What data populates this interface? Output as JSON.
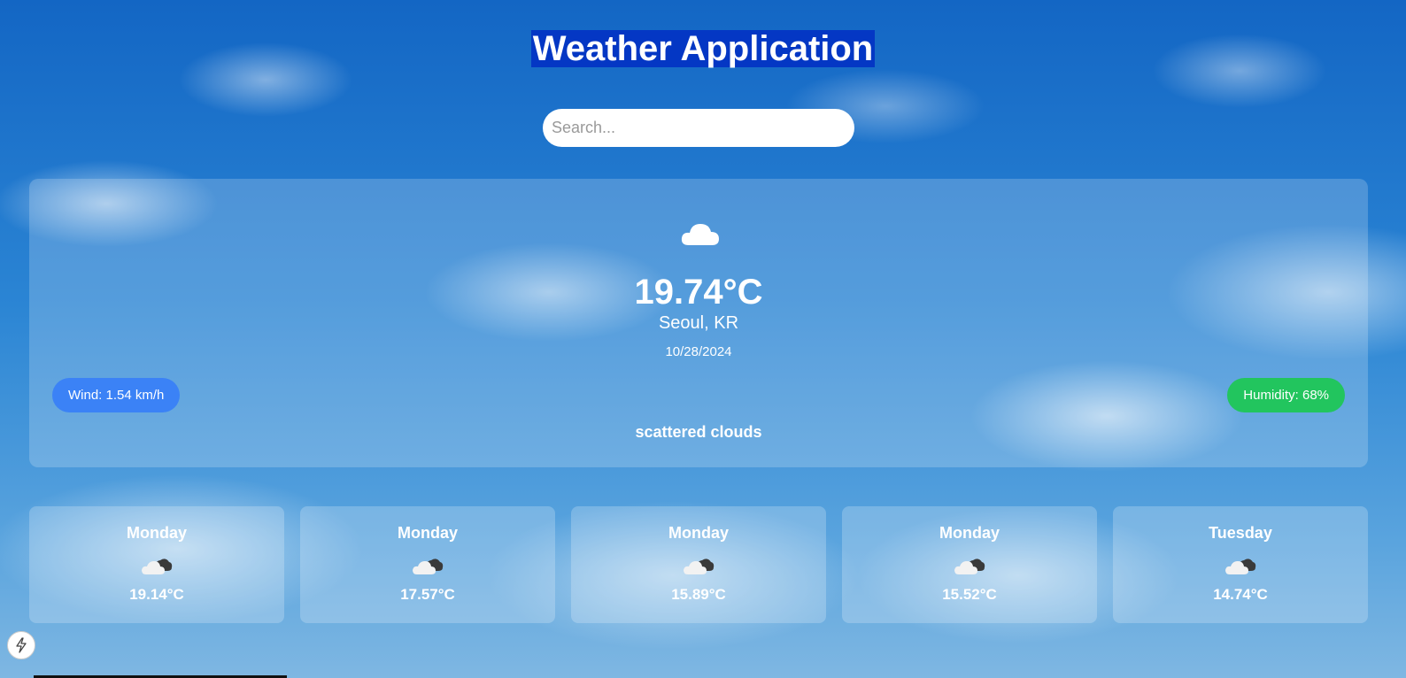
{
  "app": {
    "title": "Weather Application"
  },
  "search": {
    "placeholder": "Search...",
    "value": ""
  },
  "current": {
    "icon": "cloud-icon",
    "temperature": "19.74°C",
    "location": "Seoul, KR",
    "date": "10/28/2024",
    "wind": "Wind: 1.54 km/h",
    "humidity": "Humidity: 68%",
    "description": "scattered clouds"
  },
  "forecast": [
    {
      "day": "Monday",
      "icon": "broken-clouds-icon",
      "temp": "19.14°C"
    },
    {
      "day": "Monday",
      "icon": "broken-clouds-icon",
      "temp": "17.57°C"
    },
    {
      "day": "Monday",
      "icon": "broken-clouds-icon",
      "temp": "15.89°C"
    },
    {
      "day": "Monday",
      "icon": "broken-clouds-icon",
      "temp": "15.52°C"
    },
    {
      "day": "Tuesday",
      "icon": "broken-clouds-icon",
      "temp": "14.74°C"
    }
  ],
  "colors": {
    "title_bg": "#0437c4",
    "wind_pill": "#3b82f6",
    "humidity_pill": "#22c55e"
  },
  "extras": {
    "corner_button_icon": "lightning-bolt-icon"
  }
}
